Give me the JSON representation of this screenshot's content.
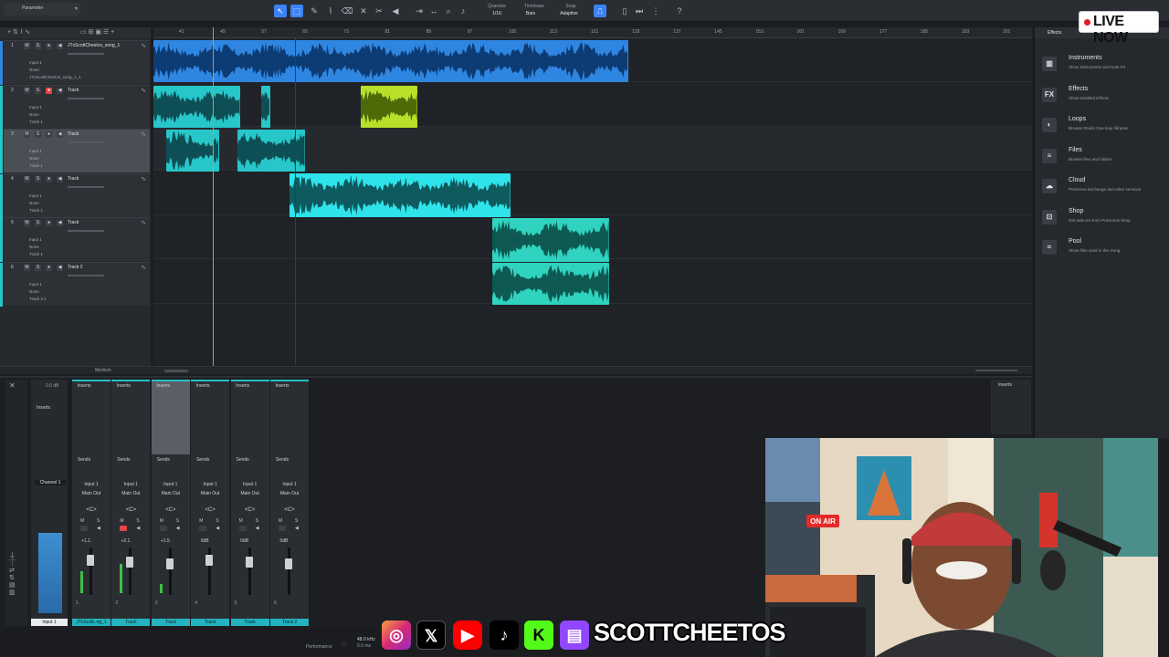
{
  "toolbar": {
    "parameter_label": "Parameter",
    "quantize_label": "Quantize",
    "quantize_value": "1/16",
    "timebase_label": "Timebase",
    "timebase_value": "Bars",
    "snap_label": "Snap",
    "snap_value": "Adaptive",
    "help": "?"
  },
  "ruler": {
    "ticks": [
      "41",
      "49",
      "57",
      "65",
      "73",
      "81",
      "89",
      "97",
      "105",
      "113",
      "121",
      "129",
      "137",
      "145",
      "153",
      "161",
      "169",
      "177",
      "185",
      "193",
      "201"
    ]
  },
  "tracks": [
    {
      "num": "1",
      "name": "JTxScottCheetos_song_1",
      "input": "Input 1",
      "sub": "None",
      "out": "JTxScottCheetos_song_1_1",
      "color": "#2f86e0"
    },
    {
      "num": "2",
      "name": "Track",
      "input": "Input 1",
      "sub": "None",
      "out": "Track 1",
      "color": "#27c6c8"
    },
    {
      "num": "3",
      "name": "Track",
      "input": "Input 1",
      "sub": "None",
      "out": "Track 1",
      "color": "#27c6c8"
    },
    {
      "num": "4",
      "name": "Track",
      "input": "Input 1",
      "sub": "None",
      "out": "Track 1",
      "color": "#27c6c8"
    },
    {
      "num": "5",
      "name": "Track",
      "input": "Input 1",
      "sub": "None",
      "out": "Track 1",
      "color": "#27c6c8"
    },
    {
      "num": "6",
      "name": "Track 2",
      "input": "Input 1",
      "sub": "None",
      "out": "Track 2.1",
      "color": "#27c6c8"
    }
  ],
  "arrange_footer": {
    "zoom_label": "Medium"
  },
  "browser": {
    "tabs": [
      "Effects"
    ],
    "items": [
      {
        "icon": "piano-icon",
        "glyph": "▥",
        "title": "Instruments",
        "desc": "Show Instruments and Note FX"
      },
      {
        "icon": "fx-icon",
        "glyph": "FX",
        "title": "Effects",
        "desc": "Show installed Effects"
      },
      {
        "icon": "loop-icon",
        "glyph": "◐",
        "title": "Loops",
        "desc": "Browse Studio One loop libraries"
      },
      {
        "icon": "files-icon",
        "glyph": "≡",
        "title": "Files",
        "desc": "Browse files and folders"
      },
      {
        "icon": "cloud-icon",
        "glyph": "☁",
        "title": "Cloud",
        "desc": "PreSonus Exchange and other services"
      },
      {
        "icon": "shop-icon",
        "glyph": "⊡",
        "title": "Shop",
        "desc": "Get add-ons from PreSonus Shop"
      },
      {
        "icon": "pool-icon",
        "glyph": "≈",
        "title": "Pool",
        "desc": "Show files used in this Song"
      }
    ]
  },
  "mixer": {
    "master": {
      "title": "Channel 1",
      "db": "0.0 dB",
      "name": "Input 1",
      "inserts": "Inserts"
    },
    "strips": [
      {
        "inserts": "Inserts",
        "sends": "Sends",
        "input": "Input 1",
        "output": "Main Out",
        "db": "+1.1",
        "num": "1",
        "name": "JTxScott..ng_1"
      },
      {
        "inserts": "Inserts",
        "sends": "Sends",
        "input": "Input 1",
        "output": "Main Out",
        "db": "+2.1",
        "num": "2",
        "name": "Track"
      },
      {
        "inserts": "Inserts",
        "sends": "Sends",
        "input": "Input 1",
        "output": "Main Out",
        "db": "+1.5",
        "num": "3",
        "name": "Track"
      },
      {
        "inserts": "Inserts",
        "sends": "Sends",
        "input": "Input 1",
        "output": "Main Out",
        "db": "0dB",
        "num": "4",
        "name": "Track"
      },
      {
        "inserts": "Inserts",
        "sends": "Sends",
        "input": "Input 1",
        "output": "Main Out",
        "db": "0dB",
        "num": "5",
        "name": "Track"
      },
      {
        "inserts": "Inserts",
        "sends": "Sends",
        "input": "Input 1",
        "output": "Main Out",
        "db": "0dB",
        "num": "6",
        "name": "Track 2"
      }
    ],
    "right_inserts": "Inserts"
  },
  "status": {
    "performance": "Performance",
    "rate": "48.0 kHz",
    "time": "0.0 ms"
  },
  "overlay": {
    "live_label": "LIVE NOW",
    "handle": "SCOTTCHEETOS",
    "on_air": "ON AIR",
    "socials": [
      "instagram-icon",
      "x-icon",
      "youtube-icon",
      "tiktok-icon",
      "kick-icon",
      "twitch-icon"
    ]
  }
}
